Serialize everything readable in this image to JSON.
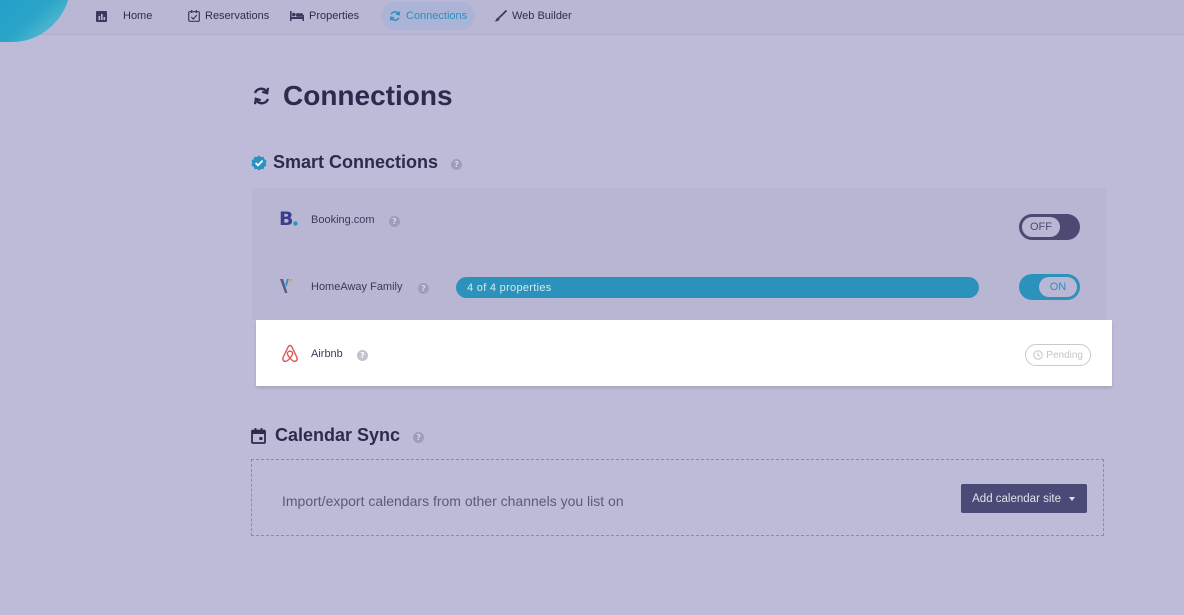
{
  "nav": {
    "items": [
      {
        "label": "Home",
        "icon": "bar-chart-icon"
      },
      {
        "label": "Reservations",
        "icon": "calendar-check-icon"
      },
      {
        "label": "Properties",
        "icon": "bed-icon"
      },
      {
        "label": "Connections",
        "icon": "sync-icon"
      },
      {
        "label": "Web Builder",
        "icon": "brush-icon"
      }
    ],
    "active": "Connections"
  },
  "page": {
    "title": "Connections"
  },
  "smart_connections": {
    "title": "Smart Connections",
    "help": "?",
    "channels": [
      {
        "name": "Booking.com",
        "help": "?",
        "toggle": "OFF"
      },
      {
        "name": "HomeAway Family",
        "help": "?",
        "toggle": "ON",
        "progress_label": "4 of 4 properties"
      },
      {
        "name": "Airbnb",
        "help": "?",
        "status": "Pending"
      }
    ]
  },
  "calendar_sync": {
    "title": "Calendar Sync",
    "help": "?",
    "description": "Import/export calendars from other channels you list on",
    "button_label": "Add calendar site"
  },
  "colors": {
    "background": "#bdbbd7",
    "accent": "#2b93bb",
    "toggle_off": "#4c4a73",
    "button": "#4b4975",
    "airbnb": "#e0565b",
    "booking": "#3b3d8f"
  }
}
